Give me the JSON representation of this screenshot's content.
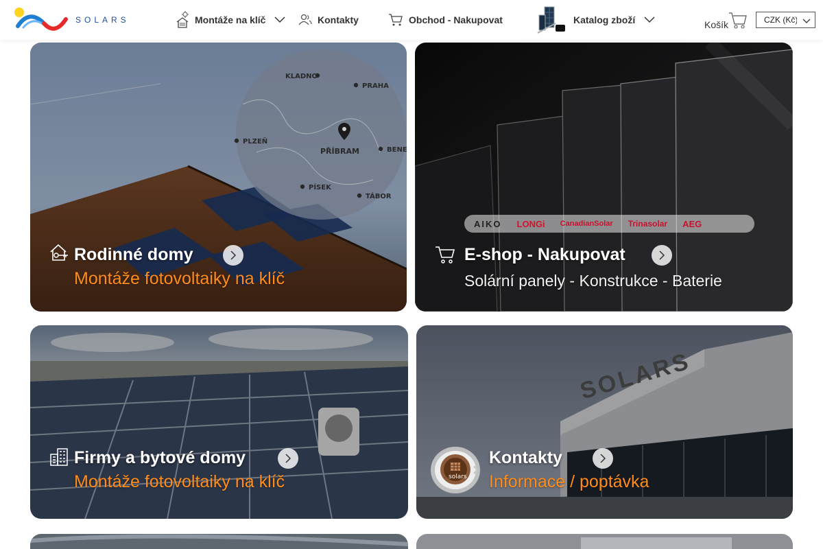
{
  "brand": {
    "name": "SOLARS"
  },
  "nav": {
    "montaze": "Montáže na klíč",
    "kontakty": "Kontakty",
    "obchod": "Obchod - Nakupovat",
    "katalog": "Katalog zboží"
  },
  "cart": {
    "label": "Košík"
  },
  "currency": {
    "selected": "CZK (Kč)"
  },
  "cards": {
    "rodinne": {
      "title": "Rodinné domy",
      "subtitle": "Montáže fotovoltaiky na klíč"
    },
    "eshop": {
      "title": "E-shop - Nakupovat",
      "subtitle": "Solární panely - Konstrukce - Baterie",
      "brands": [
        "AIKO",
        "LONGi",
        "CanadianSolar",
        "Trinasolar",
        "AEG"
      ]
    },
    "firmy": {
      "title": "Firmy a bytové domy",
      "subtitle": "Montáže fotovoltaiky na klíč"
    },
    "kontakty": {
      "title": "Kontakty",
      "subtitle": "Informace / poptávka",
      "badge": "solars"
    }
  },
  "map": {
    "cities": [
      "KLADNO",
      "PRAHA",
      "PLZEŇ",
      "PŘÍBRAM",
      "BENEŠ",
      "PÍSEK",
      "TÁBOR"
    ]
  },
  "building_sign": "SOLARS",
  "colors": {
    "accent_orange": "#ff8c1a",
    "brand_blue": "#1f4fa0",
    "brand_red": "#e52a2a",
    "brand_yellow": "#ffd21f"
  }
}
